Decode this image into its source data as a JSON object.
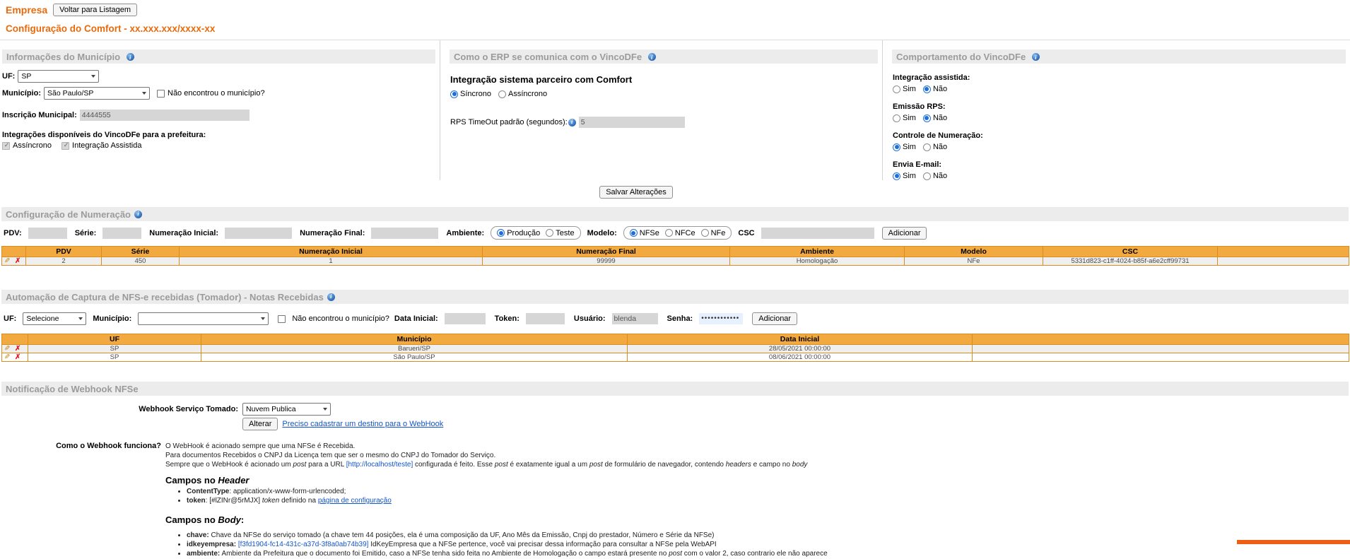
{
  "accent_color": "#EA6A0B",
  "table_header_color": "#F2A93F",
  "link_color": "#1155CC",
  "header": {
    "app_title": "Empresa",
    "back_button": "Voltar para Listagem",
    "page_title": "Configuração do Comfort - xx.xxx.xxx/xxxx-xx"
  },
  "municipio_panel": {
    "title": "Informações do Município",
    "uf_label": "UF:",
    "uf_value": "SP",
    "municipio_label": "Município:",
    "municipio_value": "São Paulo/SP",
    "not_found_label": "Não encontrou o município?",
    "inscricao_label": "Inscrição Municipal:",
    "inscricao_value": "4444555",
    "integracoes_label": "Integrações disponíveis do VincoDFe para a prefeitura:",
    "check_assincrono": "Assíncrono",
    "check_assistida": "Integração Assistida"
  },
  "erp_panel": {
    "title": "Como o ERP se comunica com o VincoDFe",
    "subtitle": "Integração sistema parceiro com Comfort",
    "radio_sincrono": "Síncrono",
    "radio_assincrono": "Assíncrono",
    "rps_label": "RPS TimeOut padrão (segundos):",
    "rps_value": "5"
  },
  "comportamento_panel": {
    "title": "Comportamento do VincoDFe",
    "groups": [
      {
        "label": "Integração assistida:",
        "yes": "Sim",
        "no": "Não",
        "selected": "no"
      },
      {
        "label": "Emissão RPS:",
        "yes": "Sim",
        "no": "Não",
        "selected": "no"
      },
      {
        "label": "Controle de Numeração:",
        "yes": "Sim",
        "no": "Não",
        "selected": "yes"
      },
      {
        "label": "Envia E-mail:",
        "yes": "Sim",
        "no": "Não",
        "selected": "yes"
      }
    ]
  },
  "save_button": "Salvar Alterações",
  "numeracao": {
    "title": "Configuração de Numeração",
    "form": {
      "pdv_label": "PDV:",
      "serie_label": "Série:",
      "num_inicial_label": "Numeração Inicial:",
      "num_final_label": "Numeração Final:",
      "ambiente_label": "Ambiente:",
      "ambiente_producao": "Produção",
      "ambiente_teste": "Teste",
      "modelo_label": "Modelo:",
      "modelo_nfse": "NFSe",
      "modelo_nfce": "NFCe",
      "modelo_nfe": "NFe",
      "csc_label": "CSC",
      "add_button": "Adicionar"
    },
    "table": {
      "headers": [
        "PDV",
        "Série",
        "Numeração Inicial",
        "Numeração Final",
        "Ambiente",
        "Modelo",
        "CSC"
      ],
      "rows": [
        {
          "pdv": "2",
          "serie": "450",
          "num_inicial": "1",
          "num_final": "99999",
          "ambiente": "Homologação",
          "modelo": "NFe",
          "csc": "5331d823-c1ff-4024-b85f-a6e2cff99731"
        }
      ]
    }
  },
  "automacao": {
    "title": "Automação de Captura de NFS-e recebidas (Tomador) - Notas Recebidas",
    "form": {
      "uf_label": "UF:",
      "uf_value": "Selecione",
      "municipio_label": "Município:",
      "municipio_value": "",
      "not_found_label": "Não encontrou o município?",
      "data_inicial_label": "Data Inicial:",
      "token_label": "Token:",
      "usuario_label": "Usuário:",
      "usuario_value": "blenda",
      "senha_label": "Senha:",
      "senha_value": "••••••••••••",
      "add_button": "Adicionar"
    },
    "table": {
      "headers": [
        "UF",
        "Município",
        "Data Inicial"
      ],
      "rows": [
        {
          "uf": "SP",
          "municipio": "Barueri/SP",
          "data_inicial": "28/05/2021 00:00:00"
        },
        {
          "uf": "SP",
          "municipio": "São Paulo/SP",
          "data_inicial": "08/06/2021 00:00:00"
        }
      ]
    }
  },
  "webhook": {
    "title": "Notificação de Webhook NFSe",
    "servico_label": "Webhook Serviço Tomado:",
    "servico_value": "Nuvem Publica",
    "alterar_button": "Alterar",
    "destino_link": "Preciso cadastrar um destino para o WebHook",
    "question_label": "Como o Webhook funciona?",
    "line1": "O WebHook é acionado sempre que uma NFSe é Recebida.",
    "line2": "Para documentos Recebidos o CNPJ da Licença tem que ser o mesmo do CNPJ do Tomador do Serviço.",
    "line3": {
      "p1": "Sempre que o WebHook é acionado um ",
      "i1": "post",
      "p2": " para a URL ",
      "url": "[http://localhost/teste]",
      "p3": " configurada é feito. Esse ",
      "i2": "post",
      "p4": " é exatamente igual a um ",
      "i3": "post",
      "p5": " de formulário de navegador, contendo ",
      "i4": "headers",
      "p6": " e campo no ",
      "i5": "body"
    },
    "header_title": {
      "p": "Campos no ",
      "i": "Header"
    },
    "hb1": {
      "term": "ContentType",
      "text": ": application/x-www-form-urlencoded;"
    },
    "hb2": {
      "term": "token",
      "colon": ": ",
      "bracket": "[#lZINr@5rMJX] ",
      "i": "token",
      "text": " definido na ",
      "link": "página de configuração"
    },
    "body_title": {
      "p": "Campos no ",
      "i": "Body",
      "s": ":"
    },
    "bb1": {
      "term": "chave:",
      "text": " Chave da NFSe do serviço tomado (a chave tem 44 posições, ela é uma composição da UF, Ano Mês da Emissão, Cnpj do prestador, Número e Série da NFSe)"
    },
    "bb2": {
      "term": "idkeyempresa:",
      "bracket": " [f3fd1904-fc14-431c-a37d-3f8a0ab74b39]",
      "text": " IdKeyEmpresa que a NFSe pertence, você vai precisar dessa informação para consultar a NFSe pela WebAPI"
    },
    "bb3": {
      "term": "ambiente:",
      "p1": " Ambiente da Prefeitura que o documento foi Emitido, caso a NFSe tenha sido feita no Ambiente de Homologação o campo estará presente no ",
      "i": "post",
      "p2": " com o valor 2, caso contrario ele não aparece"
    }
  }
}
